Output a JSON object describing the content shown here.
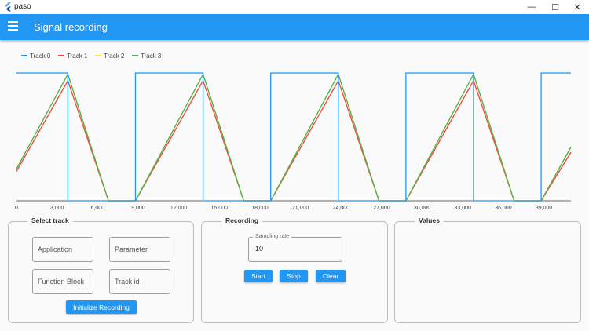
{
  "window": {
    "title": "paso",
    "minimize": "—",
    "maximize": "☐",
    "close": "✕"
  },
  "appbar": {
    "title": "Signal recording",
    "color": "#2196f3"
  },
  "chart_data": {
    "type": "line",
    "xlim": [
      0,
      41000
    ],
    "ylim": [
      0,
      1
    ],
    "xticks": [
      0,
      3000,
      6000,
      9000,
      12000,
      15000,
      18000,
      21000,
      24000,
      27000,
      30000,
      33000,
      36000,
      39000
    ],
    "xtick_labels": [
      "0",
      "3,000",
      "6,000",
      "9,000",
      "12,000",
      "15,000",
      "18,000",
      "21,000",
      "24,000",
      "27,000",
      "30,000",
      "33,000",
      "36,000",
      "39,000"
    ],
    "legend_position": "top-left",
    "grid": false,
    "series": [
      {
        "name": "Track 0",
        "color": "#2196f3",
        "x": [
          0,
          3800,
          3800,
          8800,
          8800,
          13800,
          13800,
          18800,
          18800,
          23800,
          23800,
          28800,
          28800,
          33800,
          33800,
          38800,
          38800,
          41000
        ],
        "y": [
          1,
          1,
          0,
          0,
          1,
          1,
          0,
          0,
          1,
          1,
          0,
          0,
          1,
          1,
          0,
          0,
          1,
          1
        ]
      },
      {
        "name": "Track 1",
        "color": "#f44336",
        "x": [
          0,
          3800,
          6800,
          8800,
          13800,
          16800,
          18800,
          23800,
          26800,
          28800,
          33800,
          36800,
          38800,
          41000
        ],
        "y": [
          0.23,
          0.94,
          0,
          0,
          0.94,
          0,
          0,
          0.94,
          0,
          0,
          0.94,
          0,
          0,
          0.38
        ]
      },
      {
        "name": "Track 2",
        "color": "#ffeb3b",
        "x": [
          0,
          3800,
          6800,
          8800,
          13800,
          16800,
          18800,
          23800,
          26800,
          28800,
          33800,
          36800,
          38800,
          41000
        ],
        "y": [
          0.25,
          0.99,
          0,
          0,
          0.99,
          0,
          0,
          0.99,
          0,
          0,
          0.99,
          0,
          0,
          0.42
        ]
      },
      {
        "name": "Track 3",
        "color": "#4caf50",
        "x": [
          0,
          3800,
          6800,
          8800,
          13800,
          16800,
          18800,
          23800,
          26800,
          28800,
          33800,
          36800,
          38800,
          41000
        ],
        "y": [
          0.25,
          0.99,
          0,
          0,
          0.99,
          0,
          0,
          0.99,
          0,
          0,
          0.99,
          0,
          0,
          0.42
        ]
      }
    ]
  },
  "select_track": {
    "title": "Select track",
    "application_placeholder": "Application",
    "parameter_placeholder": "Parameter",
    "function_block_placeholder": "Function Block",
    "track_id_placeholder": "Track id",
    "init_button": "Initialize Recording"
  },
  "recording": {
    "title": "Recording",
    "sampling_label": "Sampling rate",
    "sampling_value": "10",
    "start": "Start",
    "stop": "Stop",
    "clear": "Clear"
  },
  "values": {
    "title": "Values"
  }
}
